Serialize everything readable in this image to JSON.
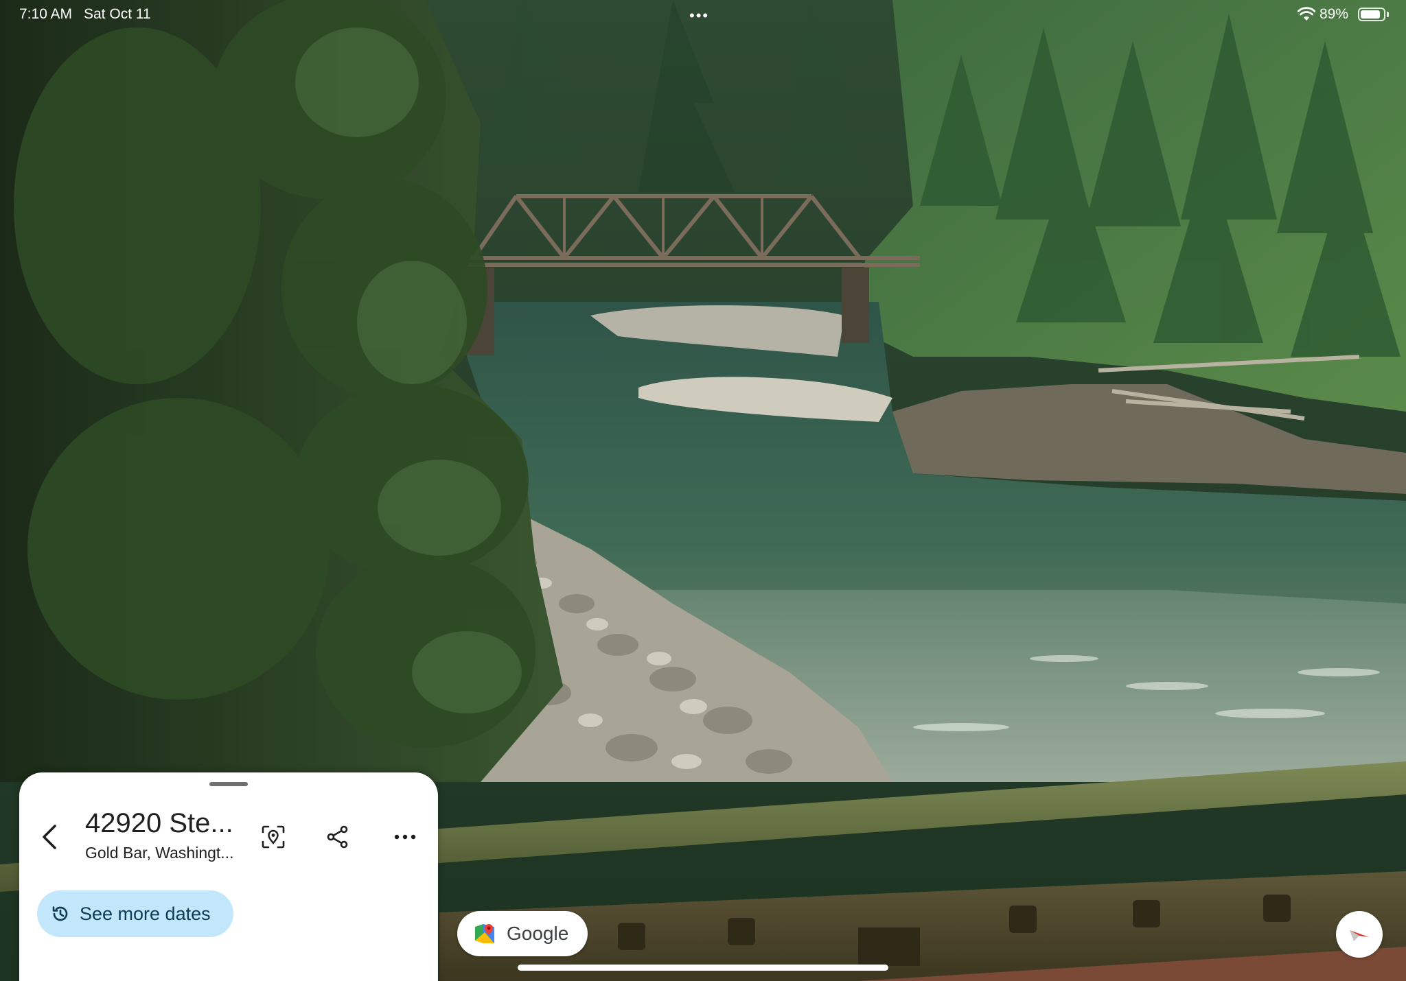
{
  "status_bar": {
    "time": "7:10 AM",
    "date": "Sat Oct 11",
    "multitask_dots": "•••",
    "battery_percent": "89%",
    "battery_level": 0.89,
    "wifi_icon": "wifi-icon",
    "battery_icon": "battery-icon"
  },
  "place_panel": {
    "title": "42920 Ste...",
    "subtitle": "Gold Bar, Washingt...",
    "see_more_dates": "See more dates",
    "icons": {
      "back": "back-arrow-icon",
      "pin": "location-pin-frame-icon",
      "share": "share-icon",
      "more": "more-horizontal-icon",
      "history": "history-icon"
    }
  },
  "google_chip": {
    "label": "Google",
    "icon": "google-maps-logo-icon"
  },
  "compass": {
    "icon": "compass-needle-icon"
  },
  "colors": {
    "dates_button_bg": "#c2e7fb",
    "panel_bg": "#ffffff",
    "compass_red": "#d93025"
  }
}
